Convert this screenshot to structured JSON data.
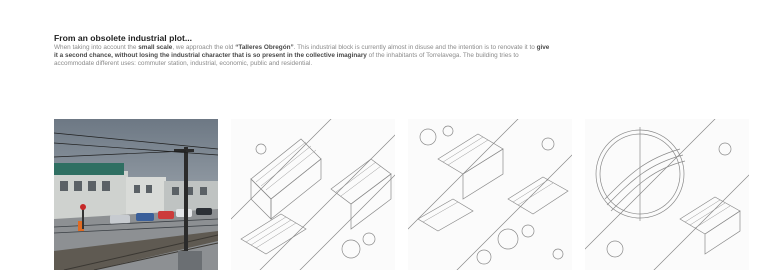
{
  "heading": "From an obsolete industrial plot...",
  "description": [
    {
      "text": "When taking into account the ",
      "bold": false
    },
    {
      "text": "small scale",
      "bold": true
    },
    {
      "text": ", we approach the old ",
      "bold": false
    },
    {
      "text": "“Talleres Obregón”",
      "bold": true
    },
    {
      "text": ". This industrial block is currently almost in disuse and the intention is to renovate it to ",
      "bold": false
    },
    {
      "text": "give it a second chance, without losing the industrial character that is so present in the collective imaginary",
      "bold": true
    },
    {
      "text": " of the inhabitants of Torrelavega. The building tries to accommodate different uses: commuter station, industrial, economic, public and residential.",
      "bold": false
    }
  ],
  "images": [
    {
      "name": "street-photo-image",
      "kind": "photo"
    },
    {
      "name": "axonometric-drawing-1",
      "kind": "drawing"
    },
    {
      "name": "axonometric-drawing-2",
      "kind": "drawing"
    },
    {
      "name": "axonometric-drawing-3",
      "kind": "drawing"
    }
  ]
}
